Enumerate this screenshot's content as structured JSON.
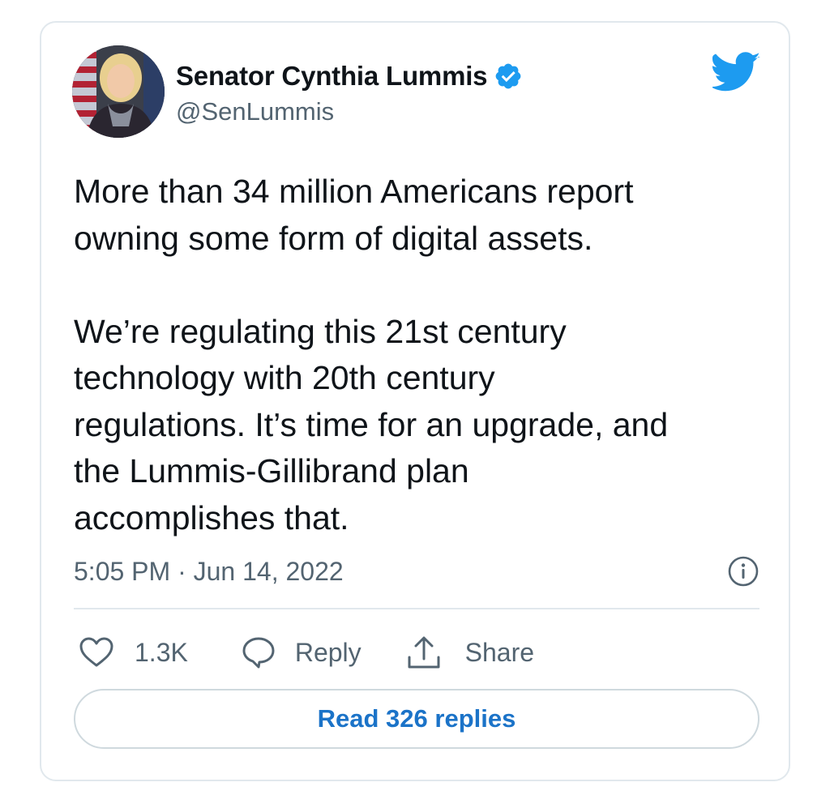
{
  "tweet": {
    "author": {
      "display_name": "Senator Cynthia Lummis",
      "handle": "@SenLummis",
      "verified": true,
      "avatar_icon": "user-avatar"
    },
    "brand_icon": "twitter-bird-icon",
    "text_lines": [
      "More than 34 million Americans report",
      "owning some form of digital assets.",
      "",
      "We’re regulating this 21st century",
      "technology with 20th century",
      "regulations. It’s time for an upgrade, and",
      "the Lummis-Gillibrand plan",
      "accomplishes that."
    ],
    "timestamp": "5:05 PM · Jun 14, 2022",
    "info_icon": "info-icon",
    "actions": {
      "like_count": "1.3K",
      "reply_label": "Reply",
      "share_label": "Share"
    },
    "read_replies_label": "Read 326 replies"
  },
  "colors": {
    "twitter_blue": "#1d9bf0",
    "link_blue": "#1b73c8",
    "secondary_text": "#536471",
    "primary_text": "#0f1419",
    "border": "#e1e8ed"
  }
}
